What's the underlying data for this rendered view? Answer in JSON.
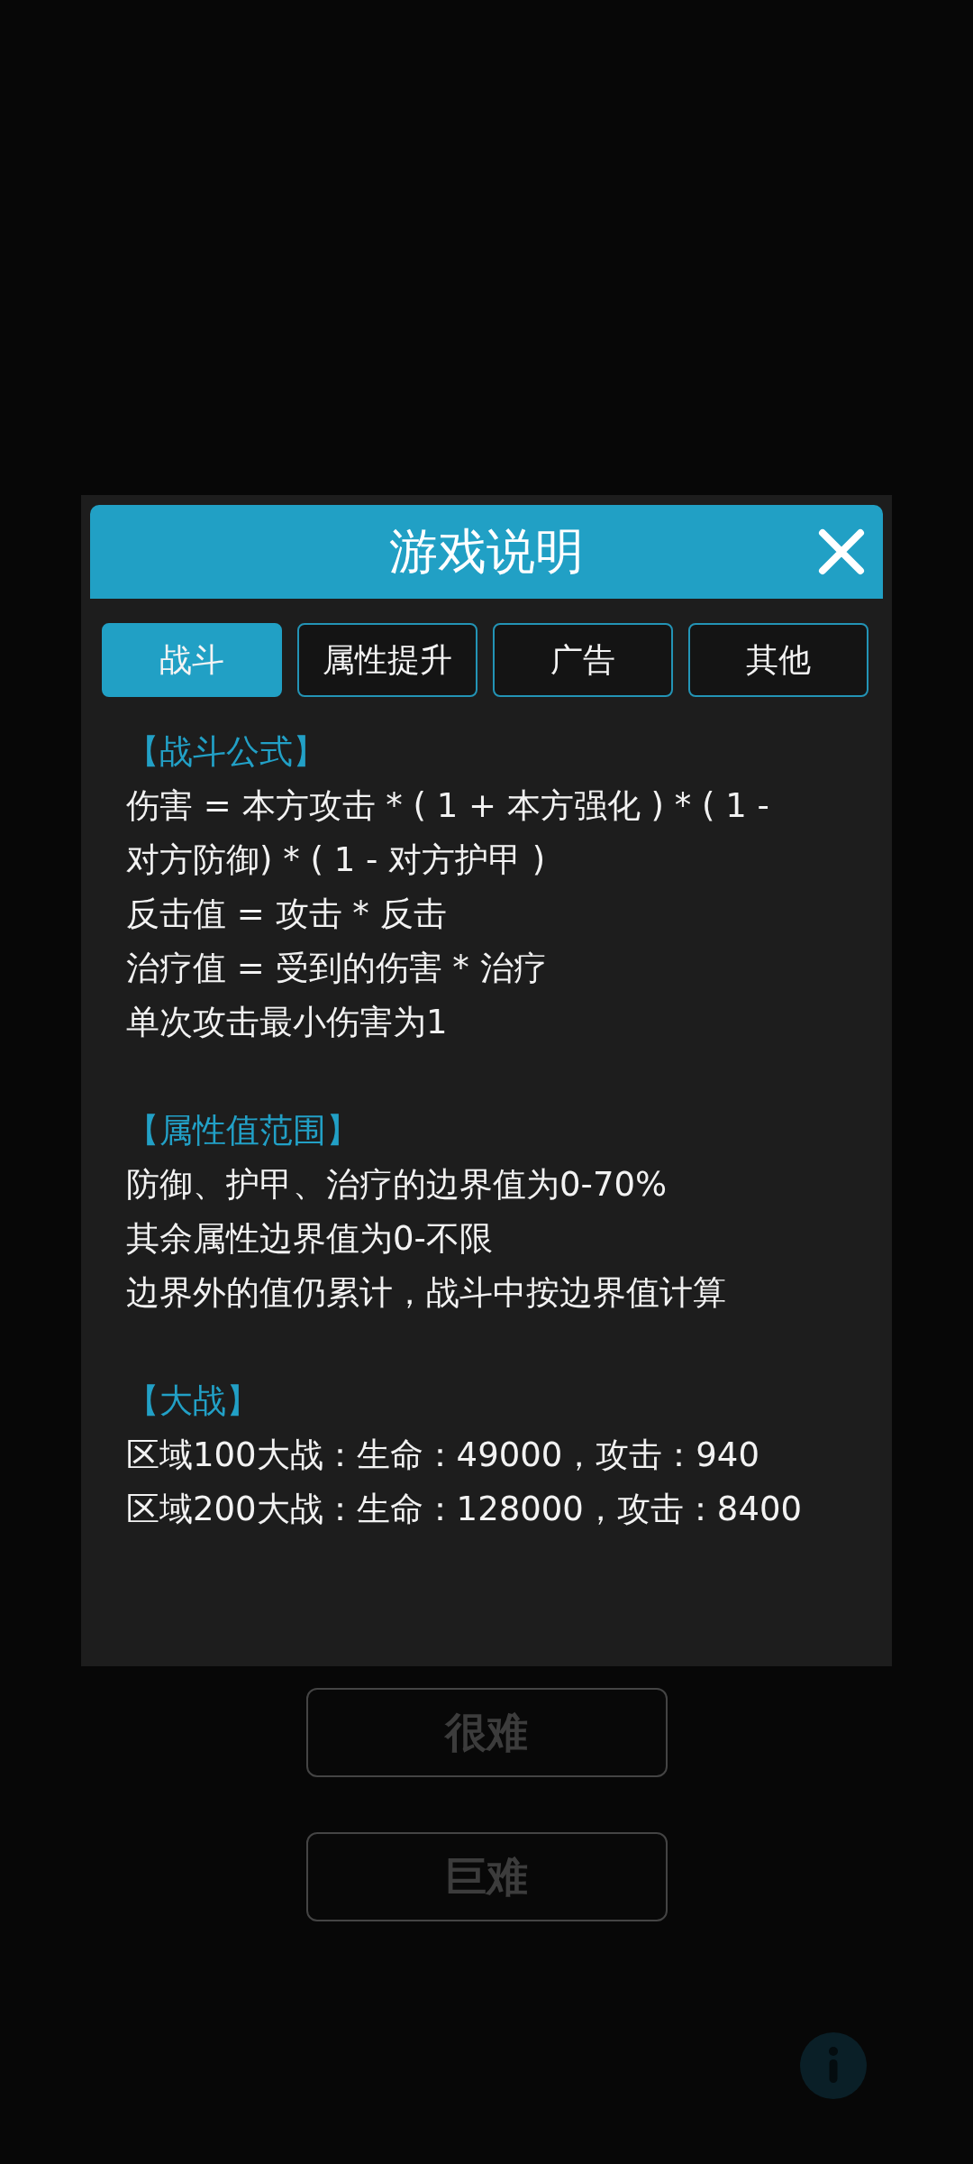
{
  "dialog": {
    "title": "游戏说明",
    "tabs": [
      {
        "label": "战斗",
        "selected": true
      },
      {
        "label": "属性提升",
        "selected": false
      },
      {
        "label": "广告",
        "selected": false
      },
      {
        "label": "其他",
        "selected": false
      }
    ],
    "sections": [
      {
        "heading": "【战斗公式】",
        "lines": [
          "伤害 = 本方攻击 * ( 1 + 本方强化 ) * ( 1 - 对方防御) * ( 1 - 对方护甲 )",
          "反击值 = 攻击 * 反击",
          "治疗值 = 受到的伤害 * 治疗",
          "单次攻击最小伤害为1"
        ]
      },
      {
        "heading": "【属性值范围】",
        "lines": [
          "防御、护甲、治疗的边界值为0-70%",
          "其余属性边界值为0-不限",
          "边界外的值仍累计，战斗中按边界值计算"
        ]
      },
      {
        "heading": "【大战】",
        "lines": [
          "区域100大战：生命：49000，攻击：940",
          "区域200大战：生命：128000，攻击：8400"
        ]
      }
    ]
  },
  "difficulty_buttons": [
    {
      "label": "很难"
    },
    {
      "label": "巨难"
    }
  ]
}
